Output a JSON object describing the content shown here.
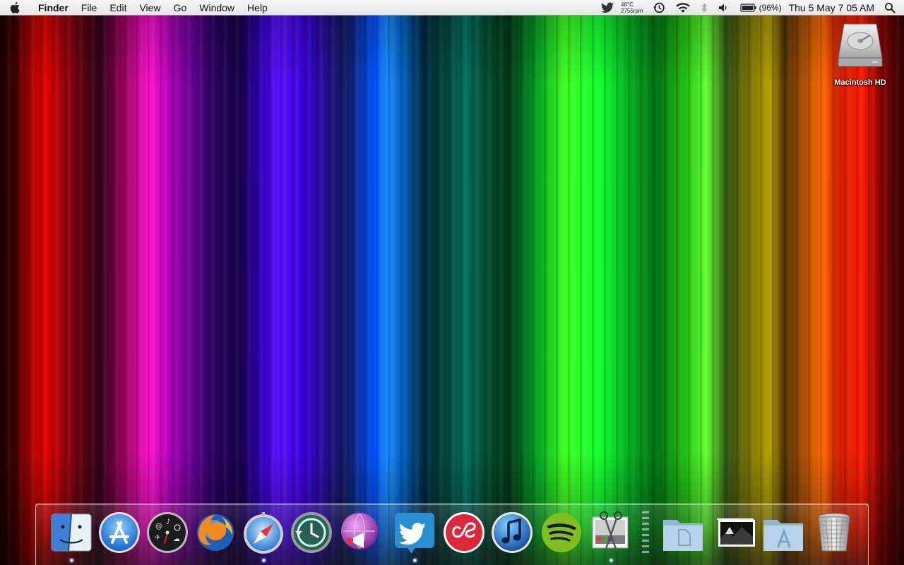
{
  "menubar": {
    "app_name": "Finder",
    "menus": [
      "File",
      "Edit",
      "View",
      "Go",
      "Window",
      "Help"
    ],
    "status": {
      "temperature": "46°C",
      "fan_speed": "2755rpm",
      "battery_percent": "(96%)",
      "clock": "Thu 5 May  7 05 AM"
    }
  },
  "desktop": {
    "icons": [
      {
        "label": "Macintosh HD",
        "icon": "hard-drive-icon"
      }
    ]
  },
  "dock": {
    "apps": [
      {
        "name": "finder",
        "icon": "finder-icon",
        "running": true
      },
      {
        "name": "app-store",
        "icon": "app-store-icon",
        "running": false
      },
      {
        "name": "dashboard",
        "icon": "dashboard-icon",
        "running": false
      },
      {
        "name": "firefox",
        "icon": "firefox-icon",
        "running": false
      },
      {
        "name": "safari",
        "icon": "safari-icon",
        "running": true
      },
      {
        "name": "time-machine",
        "icon": "time-machine-icon",
        "running": false
      },
      {
        "name": "growl",
        "icon": "growl-icon",
        "running": false
      },
      {
        "name": "twitter",
        "icon": "twitter-icon",
        "running": true
      },
      {
        "name": "lastfm",
        "icon": "lastfm-icon",
        "running": false
      },
      {
        "name": "itunes",
        "icon": "itunes-icon",
        "running": false
      },
      {
        "name": "spotify",
        "icon": "spotify-icon",
        "running": false
      },
      {
        "name": "preview",
        "icon": "preview-icon",
        "running": true
      }
    ],
    "stacks": [
      {
        "name": "documents",
        "icon": "documents-folder-icon"
      },
      {
        "name": "pictures",
        "icon": "pictures-stack-icon"
      },
      {
        "name": "applications",
        "icon": "applications-folder-icon"
      },
      {
        "name": "trash",
        "icon": "trash-icon"
      }
    ]
  }
}
